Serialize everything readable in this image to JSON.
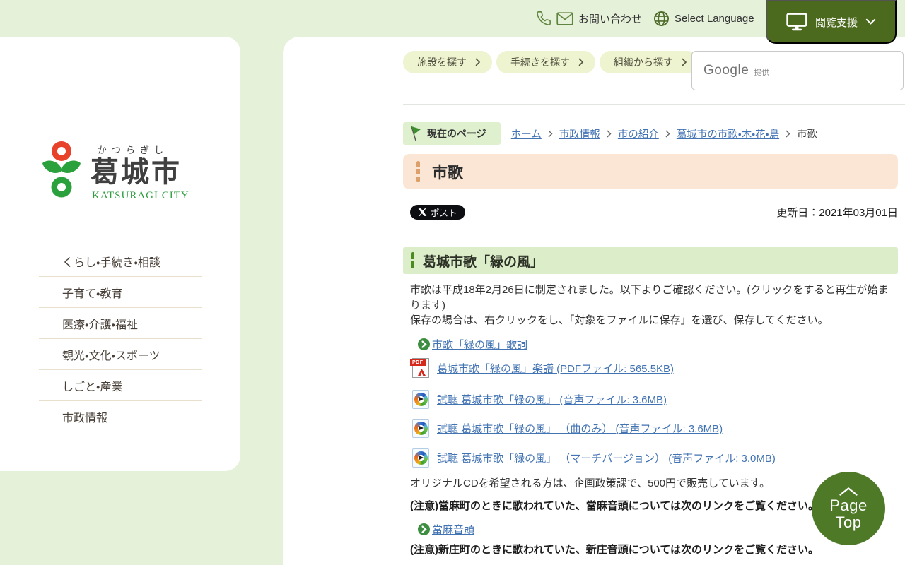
{
  "topbar": {
    "contact": "お問い合わせ",
    "select_language": "Select Language",
    "support": "閲覧支援"
  },
  "logo": {
    "furigana": "かつらぎし",
    "name": "葛城市",
    "name_en": "KATSURAGI CITY"
  },
  "sidebar": {
    "menu": [
      {
        "label": "くらし・手続き・相談"
      },
      {
        "label": "子育て・教育"
      },
      {
        "label": "医療・介護・福祉"
      },
      {
        "label": "観光・文化・スポーツ"
      },
      {
        "label": "しごと・産業"
      },
      {
        "label": "市政情報"
      }
    ]
  },
  "quicknav": {
    "buttons": [
      {
        "label": "施設を探す"
      },
      {
        "label": "手続きを探す"
      },
      {
        "label": "組織から探す"
      }
    ]
  },
  "search": {
    "brand": "Google",
    "provided": "提供",
    "value": ""
  },
  "breadcrumb": {
    "current_page_label": "現在のページ",
    "items": [
      {
        "label": "ホーム"
      },
      {
        "label": "市政情報"
      },
      {
        "label": "市の紹介"
      },
      {
        "label": "葛城市の市歌・木・花・鳥"
      },
      {
        "label": "市歌"
      }
    ]
  },
  "page": {
    "title": "市歌",
    "post": "ポスト",
    "updated": "更新日：2021年03月01日"
  },
  "content": {
    "section_heading": "葛城市歌「緑の風」",
    "para1": "市歌は平成18年2月26日に制定されました。以下よりご確認ください。(クリックをすると再生が始まります)",
    "para2": "保存の場合は、右クリックをし、「対象をファイルに保存」を選び、保存してください。",
    "links": [
      {
        "label": "市歌「緑の風」歌詞",
        "icon": "arrow-circle"
      },
      {
        "label": "葛城市歌「緑の風」楽譜 (PDFファイル: 565.5KB)",
        "icon": "pdf"
      },
      {
        "label": "試聴 葛城市歌「緑の風」 (音声ファイル: 3.6MB)",
        "icon": "audio"
      },
      {
        "label": "試聴 葛城市歌「緑の風」 （曲のみ） (音声ファイル: 3.6MB)",
        "icon": "audio"
      },
      {
        "label": "試聴 葛城市歌「緑の風」 （マーチバージョン） (音声ファイル: 3.0MB)",
        "icon": "audio"
      }
    ],
    "para3": "オリジナルCDを希望される方は、企画政策課で、500円で販売しています。",
    "note_taima": "(注意)當麻町のときに歌われていた、當麻音頭については次のリンクをご覧ください。",
    "link_taima": "當麻音頭",
    "note_shinjo": "(注意)新庄町のときに歌われていた、新庄音頭については次のリンクをご覧ください。"
  },
  "pagetop": {
    "line1": "Page",
    "line2": "Top"
  },
  "colors": {
    "page_bg": "#e6f1da",
    "header_green": "#4c6a1e",
    "pagetop_green": "#4e7a28",
    "title_peach": "#fbe6d5",
    "section_green": "#dcedca",
    "link_blue": "#4273b3",
    "logo_red": "#e8432a",
    "logo_green": "#2ba13d"
  }
}
